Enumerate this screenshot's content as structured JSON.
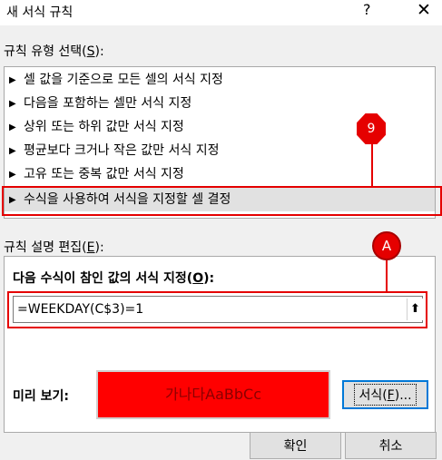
{
  "dialog": {
    "title": "새 서식 규칙",
    "help_glyph": "?",
    "close_glyph": "✕"
  },
  "rule_type": {
    "label_prefix": "규칙 유형 선택(",
    "label_key": "S",
    "label_suffix": "):",
    "items": [
      {
        "label": "셀 값을 기준으로 모든 셀의 서식 지정",
        "selected": false
      },
      {
        "label": "다음을 포함하는 셀만 서식 지정",
        "selected": false
      },
      {
        "label": "상위 또는 하위 값만 서식 지정",
        "selected": false
      },
      {
        "label": "평균보다 크거나 작은 값만 서식 지정",
        "selected": false
      },
      {
        "label": "고유 또는 중복 값만 서식 지정",
        "selected": false
      },
      {
        "label": "수식을 사용하여 서식을 지정할 셀 결정",
        "selected": true
      }
    ],
    "item_marker": "▶"
  },
  "rule_description": {
    "label_prefix": "규칙 설명 편집(",
    "label_key": "E",
    "label_suffix": "):",
    "condition_prefix": "다음 수식이 참인 값의 서식 지정(",
    "condition_key": "O",
    "condition_suffix": "):",
    "formula_value": "=WEEKDAY(C$3)=1",
    "collapse_glyph": "⬆",
    "preview_label": "미리 보기:",
    "preview_text": "가나다AaBbCc",
    "preview_fill_color": "#ff0000",
    "format_button_prefix": "서식(",
    "format_button_key": "F",
    "format_button_suffix": ")..."
  },
  "buttons": {
    "ok_label": "확인",
    "cancel_label": "취소"
  },
  "annotations": {
    "callout_9": "9",
    "callout_a": "A",
    "color": "#e50000"
  }
}
